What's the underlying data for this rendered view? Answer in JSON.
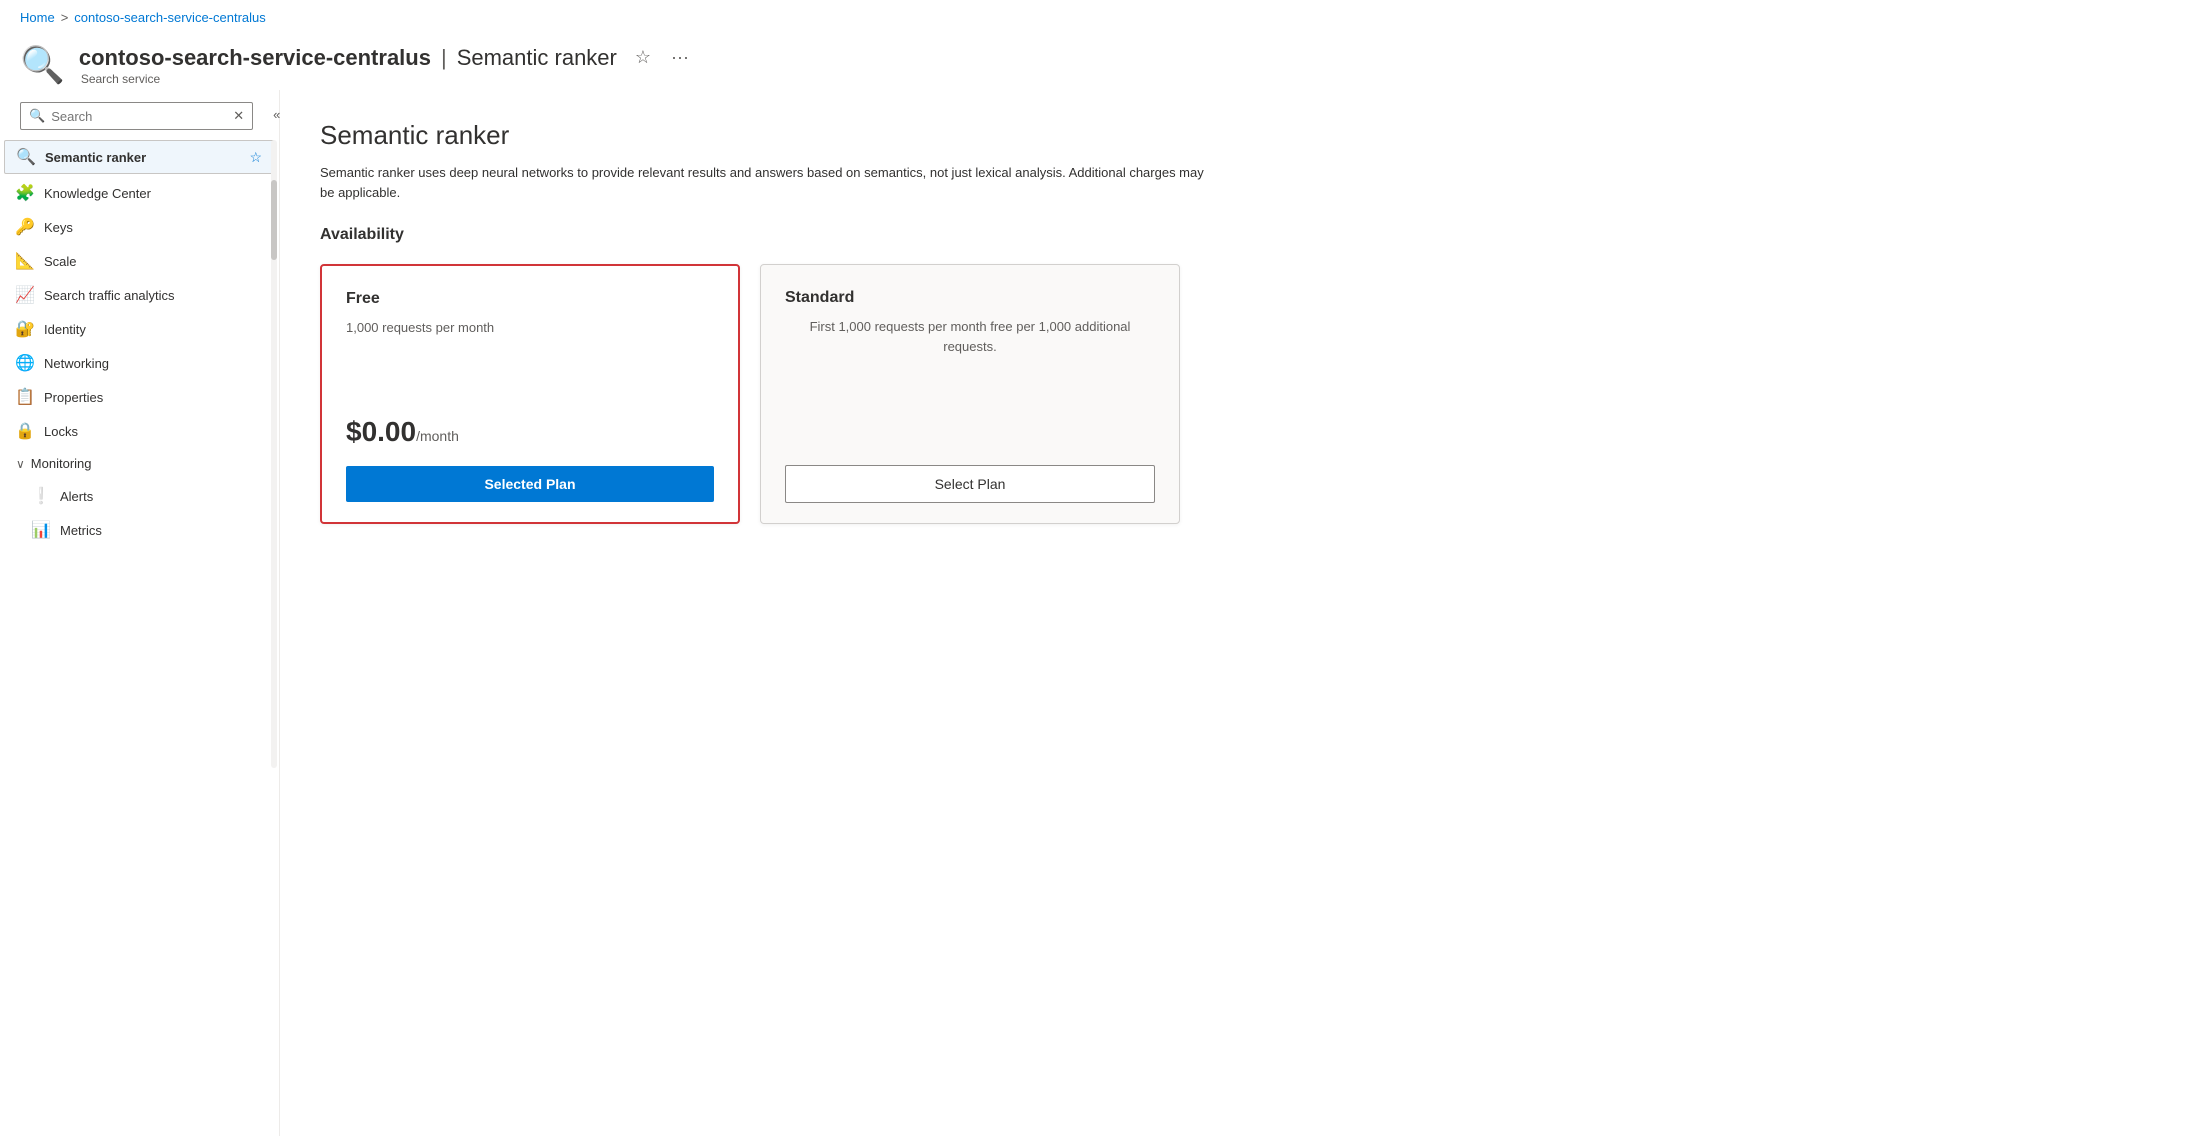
{
  "breadcrumb": {
    "home": "Home",
    "separator": ">",
    "service": "contoso-search-service-centralus"
  },
  "header": {
    "icon": "🔍",
    "title": "contoso-search-service-centralus",
    "separator": "|",
    "subtitle": "Semantic ranker",
    "subtitle_text": "Search service",
    "star_icon": "☆",
    "more_icon": "···"
  },
  "sidebar": {
    "search": {
      "placeholder": "Search",
      "value": ""
    },
    "items": [
      {
        "id": "semantic-ranker",
        "label": "Semantic ranker",
        "icon": "🔍",
        "active": true,
        "star": true
      },
      {
        "id": "knowledge-center",
        "label": "Knowledge Center",
        "icon": "🧩",
        "active": false,
        "star": false
      },
      {
        "id": "keys",
        "label": "Keys",
        "icon": "🔑",
        "active": false,
        "star": false
      },
      {
        "id": "scale",
        "label": "Scale",
        "icon": "📊",
        "active": false,
        "star": false
      },
      {
        "id": "search-traffic-analytics",
        "label": "Search traffic analytics",
        "icon": "📈",
        "active": false,
        "star": false
      },
      {
        "id": "identity",
        "label": "Identity",
        "icon": "🔐",
        "active": false,
        "star": false
      },
      {
        "id": "networking",
        "label": "Networking",
        "icon": "🌐",
        "active": false,
        "star": false
      },
      {
        "id": "properties",
        "label": "Properties",
        "icon": "📋",
        "active": false,
        "star": false
      },
      {
        "id": "locks",
        "label": "Locks",
        "icon": "🔒",
        "active": false,
        "star": false
      }
    ],
    "monitoring": {
      "label": "Monitoring",
      "items": [
        {
          "id": "alerts",
          "label": "Alerts",
          "icon": "❕"
        },
        {
          "id": "metrics",
          "label": "Metrics",
          "icon": "📊"
        }
      ]
    }
  },
  "content": {
    "title": "Semantic ranker",
    "description": "Semantic ranker uses deep neural networks to provide relevant results and answers based on semantics, not just lexical analysis. Additional charges may be applicable.",
    "availability_heading": "Availability",
    "plans": [
      {
        "id": "free",
        "name": "Free",
        "description": "1,000 requests per month",
        "price_amount": "$0.00",
        "price_period": "/month",
        "selected": true,
        "btn_label": "Selected Plan"
      },
      {
        "id": "standard",
        "name": "Standard",
        "description": "First 1,000 requests per month free per 1,000 additional requests.",
        "price_amount": "",
        "price_period": "",
        "selected": false,
        "btn_label": "Select Plan"
      }
    ]
  }
}
